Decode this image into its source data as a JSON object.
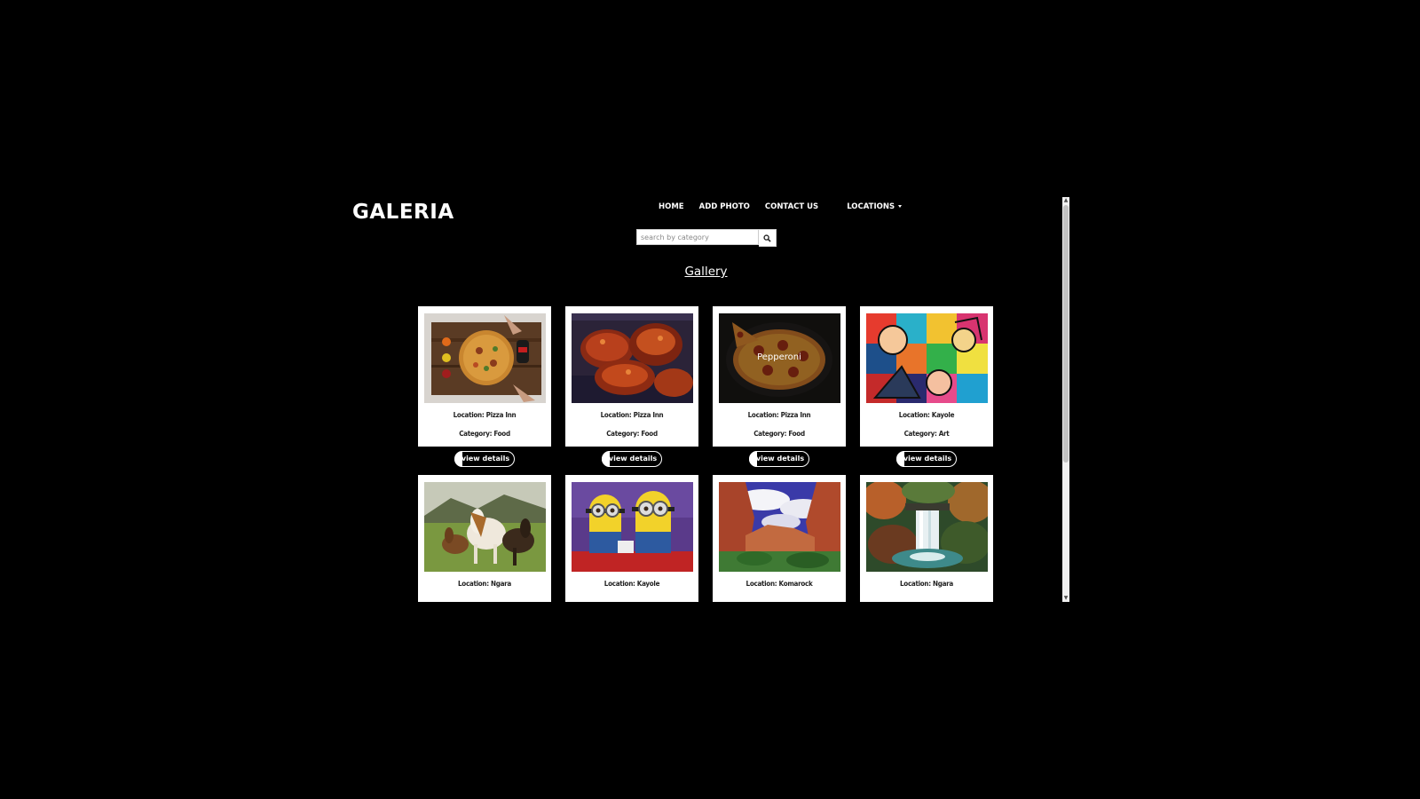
{
  "brand": "GALERIA",
  "nav": {
    "home": "HOME",
    "add_photo": "ADD PHOTO",
    "contact": "CONTACT US",
    "locations": "LOCATIONS"
  },
  "search": {
    "placeholder": "search by category"
  },
  "heading": "Gallery",
  "cards": [
    {
      "location": "Location: Pizza Inn",
      "category": "Category: Food",
      "button": "view details",
      "photo": "pizza-board"
    },
    {
      "location": "Location: Pizza Inn",
      "category": "Category: Food",
      "button": "view details",
      "photo": "chicken-wings"
    },
    {
      "location": "Location: Pizza Inn",
      "category": "Category: Food",
      "button": "view details",
      "photo": "pepperoni-pizza",
      "overlay": "Pepperoni"
    },
    {
      "location": "Location: Kayole",
      "category": "Category: Art",
      "button": "view details",
      "photo": "pop-art"
    },
    {
      "location": "Location: Ngara",
      "category": "",
      "button": "",
      "photo": "horses"
    },
    {
      "location": "Location: Kayole",
      "category": "",
      "button": "",
      "photo": "minions"
    },
    {
      "location": "Location: Komarock",
      "category": "",
      "button": "",
      "photo": "canyon"
    },
    {
      "location": "Location: Ngara",
      "category": "",
      "button": "",
      "photo": "waterfall"
    }
  ]
}
